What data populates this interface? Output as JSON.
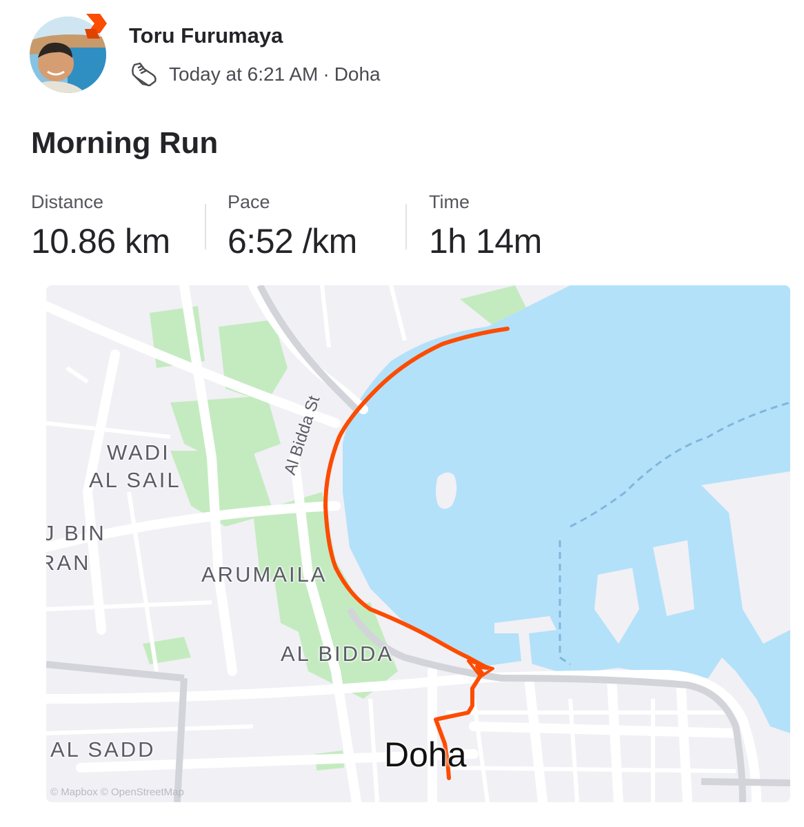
{
  "athlete": {
    "name": "Toru Furumaya"
  },
  "activity": {
    "timestamp": "Today at 6:21 AM",
    "location": "Doha",
    "separator": "·",
    "sport_icon": "running-shoe-icon",
    "title": "Morning Run"
  },
  "stats": [
    {
      "label": "Distance",
      "value": "10.86 km"
    },
    {
      "label": "Pace",
      "value": "6:52 /km"
    },
    {
      "label": "Time",
      "value": "1h 14m"
    }
  ],
  "map": {
    "labels": {
      "wadi_line1": "WADI",
      "wadi_line2": "AL SAIL",
      "bin_line1": "J BIN",
      "bin_line2": "RAN",
      "arumaila": "ARUMAILA",
      "al_bidda": "AL BIDDA",
      "al_sadd": "AL SADD",
      "street": "Al Bidda St",
      "city": "Doha"
    },
    "attribution": "© Mapbox © OpenStreetMap",
    "colors": {
      "route": "#fc4c02",
      "water": "#b3e1f9",
      "park": "#c4ebc0",
      "land": "#f1f0f5",
      "road": "#ffffff"
    }
  },
  "colors": {
    "brand": "#fc4c02",
    "text": "#242428"
  }
}
